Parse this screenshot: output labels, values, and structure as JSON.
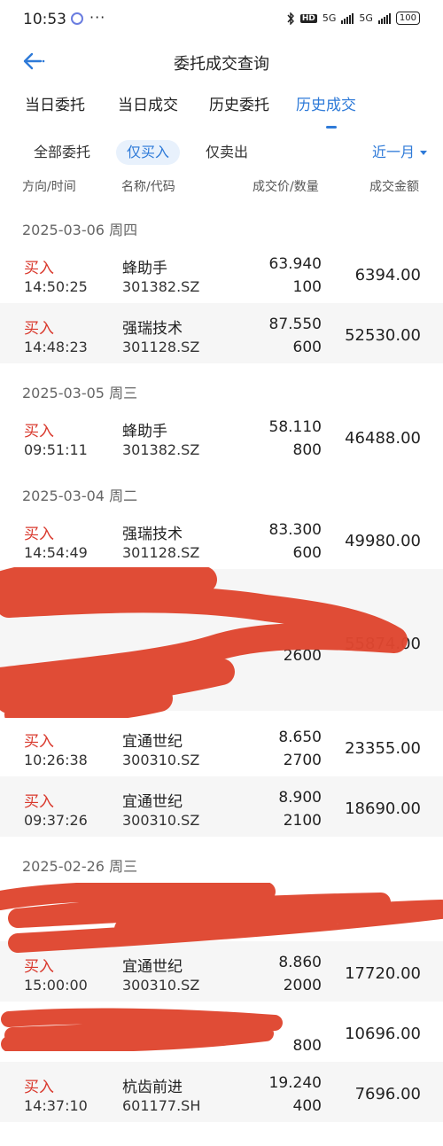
{
  "status_bar": {
    "time": "10:53",
    "more": "···",
    "hd_label": "HD",
    "net1": "5G",
    "net2": "5G",
    "battery": "100"
  },
  "nav": {
    "title": "委托成交查询",
    "back_icon": "back-arrow-icon"
  },
  "tabs": [
    "当日委托",
    "当日成交",
    "历史委托",
    "历史成交"
  ],
  "active_tab": "历史成交",
  "filters": {
    "all": "全部委托",
    "buy_only": "仅买入",
    "sell_only": "仅卖出",
    "period": "近一月"
  },
  "columns": {
    "side_time": "方向/时间",
    "name_code": "名称/代码",
    "price_qty": "成交价/数量",
    "amount": "成交金额"
  },
  "dates": [
    "2025-03-06 周四",
    "2025-03-05 周三",
    "2025-03-04 周二",
    "2025-02-26 周三"
  ],
  "trades": [
    {
      "side": "买入",
      "time": "14:50:25",
      "name": "蜂助手",
      "code": "301382.SZ",
      "price": "63.940",
      "qty": "100",
      "amount": "6394.00"
    },
    {
      "side": "买入",
      "time": "14:48:23",
      "name": "强瑞技术",
      "code": "301128.SZ",
      "price": "87.550",
      "qty": "600",
      "amount": "52530.00"
    },
    {
      "side": "买入",
      "time": "09:51:11",
      "name": "蜂助手",
      "code": "301382.SZ",
      "price": "58.110",
      "qty": "800",
      "amount": "46488.00"
    },
    {
      "side": "买入",
      "time": "14:54:49",
      "name": "强瑞技术",
      "code": "301128.SZ",
      "price": "83.300",
      "qty": "600",
      "amount": "49980.00"
    },
    {
      "side": "",
      "time": "",
      "name": "",
      "code": "",
      "price": "",
      "qty": "2600",
      "amount": "55874.00"
    },
    {
      "side": "买入",
      "time": "10:26:38",
      "name": "宜通世纪",
      "code": "300310.SZ",
      "price": "8.650",
      "qty": "2700",
      "amount": "23355.00"
    },
    {
      "side": "买入",
      "time": "09:37:26",
      "name": "宜通世纪",
      "code": "300310.SZ",
      "price": "8.900",
      "qty": "2100",
      "amount": "18690.00"
    },
    {
      "side": "",
      "time": "",
      "name": "",
      "code": "",
      "price": "",
      "qty": "",
      "amount": ""
    },
    {
      "side": "买入",
      "time": "15:00:00",
      "name": "宜通世纪",
      "code": "300310.SZ",
      "price": "8.860",
      "qty": "2000",
      "amount": "17720.00"
    },
    {
      "side": "",
      "time": "",
      "name": "",
      "code": "",
      "price": "",
      "qty": "800",
      "amount": "10696.00"
    },
    {
      "side": "买入",
      "time": "14:37:10",
      "name": "杭齿前进",
      "code": "601177.SH",
      "price": "19.240",
      "qty": "400",
      "amount": "7696.00"
    }
  ]
}
